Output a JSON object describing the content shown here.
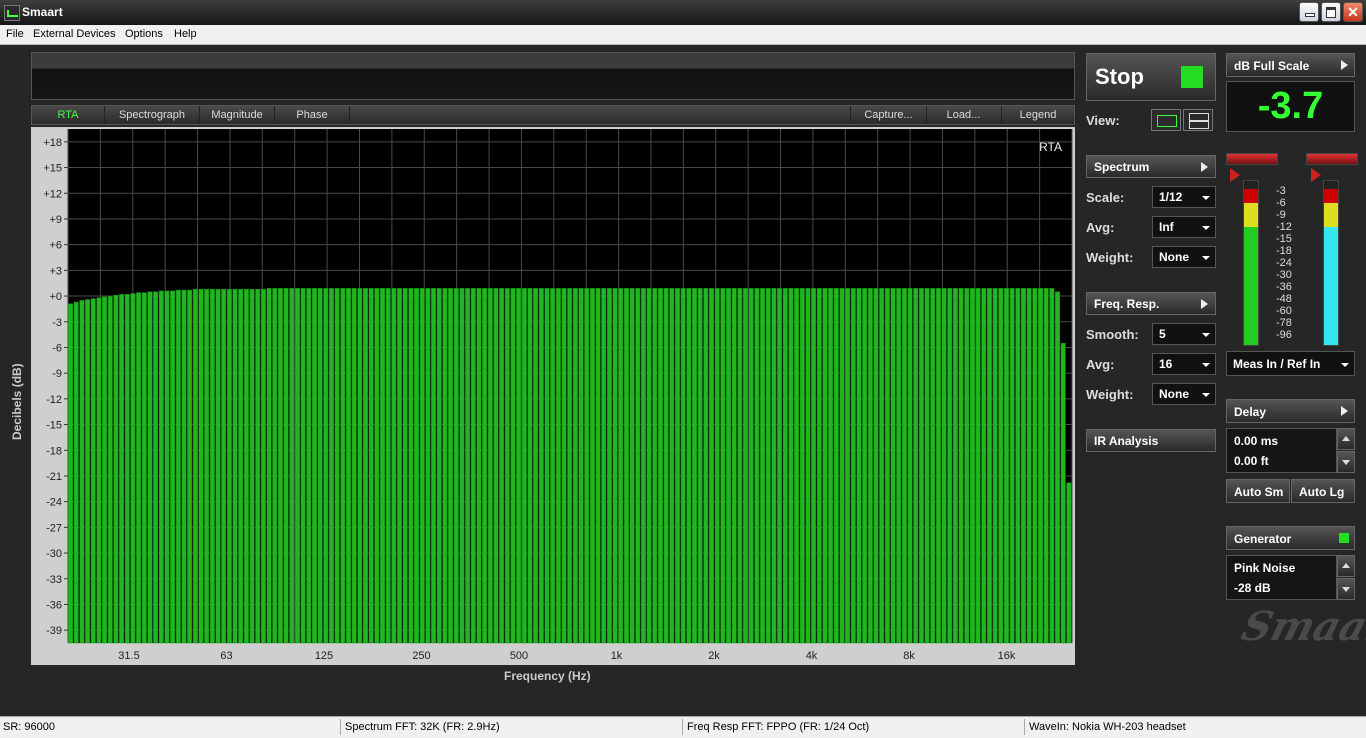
{
  "window": {
    "title": "Smaart"
  },
  "menu": [
    "File",
    "External Devices",
    "Options",
    "Help"
  ],
  "tabs": {
    "left": [
      "RTA",
      "Spectrograph",
      "Magnitude",
      "Phase"
    ],
    "right": [
      "Capture...",
      "Load...",
      "Legend"
    ],
    "active": "RTA"
  },
  "chart_data": {
    "type": "bar",
    "title": "",
    "overlay_label": "RTA",
    "xlabel": "Frequency (Hz)",
    "ylabel": "Decibels (dB)",
    "ylim": [
      -40.5,
      19.5
    ],
    "y_ticks": [
      "+18",
      "+15",
      "+12",
      "+9",
      "+6",
      "+3",
      "+0",
      "-3",
      "-6",
      "-9",
      "-12",
      "-15",
      "-18",
      "-21",
      "-24",
      "-27",
      "-30",
      "-33",
      "-36",
      "-39"
    ],
    "x_ticks": [
      "31.5",
      "63",
      "125",
      "250",
      "500",
      "1k",
      "2k",
      "4k",
      "8k",
      "16k"
    ],
    "grid": true,
    "bar_color": "#22b422",
    "values": [
      -0.9,
      -0.7,
      -0.5,
      -0.4,
      -0.3,
      -0.2,
      -0.1,
      0,
      0.1,
      0.2,
      0.2,
      0.3,
      0.4,
      0.4,
      0.5,
      0.5,
      0.6,
      0.6,
      0.6,
      0.7,
      0.7,
      0.7,
      0.8,
      0.8,
      0.8,
      0.8,
      0.8,
      0.8,
      0.8,
      0.8,
      0.8,
      0.8,
      0.8,
      0.8,
      0.8,
      0.9,
      0.9,
      0.9,
      0.9,
      0.9,
      0.9,
      0.9,
      0.9,
      0.9,
      0.9,
      0.9,
      0.9,
      0.9,
      0.9,
      0.9,
      0.9,
      0.9,
      0.9,
      0.9,
      0.9,
      0.9,
      0.9,
      0.9,
      0.9,
      0.9,
      0.9,
      0.9,
      0.9,
      0.9,
      0.9,
      0.9,
      0.9,
      0.9,
      0.9,
      0.9,
      0.9,
      0.9,
      0.9,
      0.9,
      0.9,
      0.9,
      0.9,
      0.9,
      0.9,
      0.9,
      0.9,
      0.9,
      0.9,
      0.9,
      0.9,
      0.9,
      0.9,
      0.9,
      0.9,
      0.9,
      0.9,
      0.9,
      0.9,
      0.9,
      0.9,
      0.9,
      0.9,
      0.9,
      0.9,
      0.9,
      0.9,
      0.9,
      0.9,
      0.9,
      0.9,
      0.9,
      0.9,
      0.9,
      0.9,
      0.9,
      0.9,
      0.9,
      0.9,
      0.9,
      0.9,
      0.9,
      0.9,
      0.9,
      0.9,
      0.9,
      0.9,
      0.9,
      0.9,
      0.9,
      0.9,
      0.9,
      0.9,
      0.9,
      0.9,
      0.9,
      0.9,
      0.9,
      0.9,
      0.9,
      0.9,
      0.9,
      0.9,
      0.9,
      0.9,
      0.9,
      0.9,
      0.9,
      0.9,
      0.9,
      0.9,
      0.9,
      0.9,
      0.9,
      0.9,
      0.9,
      0.9,
      0.9,
      0.9,
      0.9,
      0.9,
      0.9,
      0.9,
      0.9,
      0.9,
      0.9,
      0.9,
      0.9,
      0.9,
      0.9,
      0.9,
      0.9,
      0.9,
      0.9,
      0.9,
      0.9,
      0.9,
      0.9,
      0.9,
      0.9,
      0.5,
      -5.5,
      -21.8
    ]
  },
  "controls": {
    "stop_label": "Stop",
    "view_label": "View:",
    "fullscale_label": "dB Full Scale",
    "readout_value": "-3.7",
    "spectrum": {
      "header": "Spectrum",
      "scale_label": "Scale:",
      "scale_value": "1/12",
      "avg_label": "Avg:",
      "avg_value": "Inf",
      "weight_label": "Weight:",
      "weight_value": "None"
    },
    "freq_resp": {
      "header": "Freq. Resp.",
      "smooth_label": "Smooth:",
      "smooth_value": "5",
      "avg_label": "Avg:",
      "avg_value": "16",
      "weight_label": "Weight:",
      "weight_value": "None"
    },
    "ir_analysis_label": "IR Analysis",
    "meter_scale": [
      "-3",
      "-6",
      "-9",
      "-12",
      "-15",
      "-18",
      "-24",
      "-30",
      "-36",
      "-48",
      "-60",
      "-78",
      "-96"
    ],
    "meter_select": "Meas In / Ref In",
    "delay": {
      "header": "Delay",
      "ms": "0.00 ms",
      "ft": "0.00 ft",
      "auto_sm": "Auto Sm",
      "auto_lg": "Auto Lg"
    },
    "generator": {
      "header": "Generator",
      "type": "Pink Noise",
      "level": "-28 dB"
    },
    "logo_text": "Smaart"
  },
  "status": {
    "sr": "SR: 96000",
    "spectrum_fft": "Spectrum FFT: 32K (FR: 2.9Hz)",
    "freq_resp_fft": "Freq Resp FFT: FPPO (FR: 1/24 Oct)",
    "wavein": "WaveIn: Nokia WH-203 headset"
  },
  "colors": {
    "accent_green": "#33ff33",
    "bar_green": "#22b422",
    "meter_cyan": "#33e6f0"
  }
}
